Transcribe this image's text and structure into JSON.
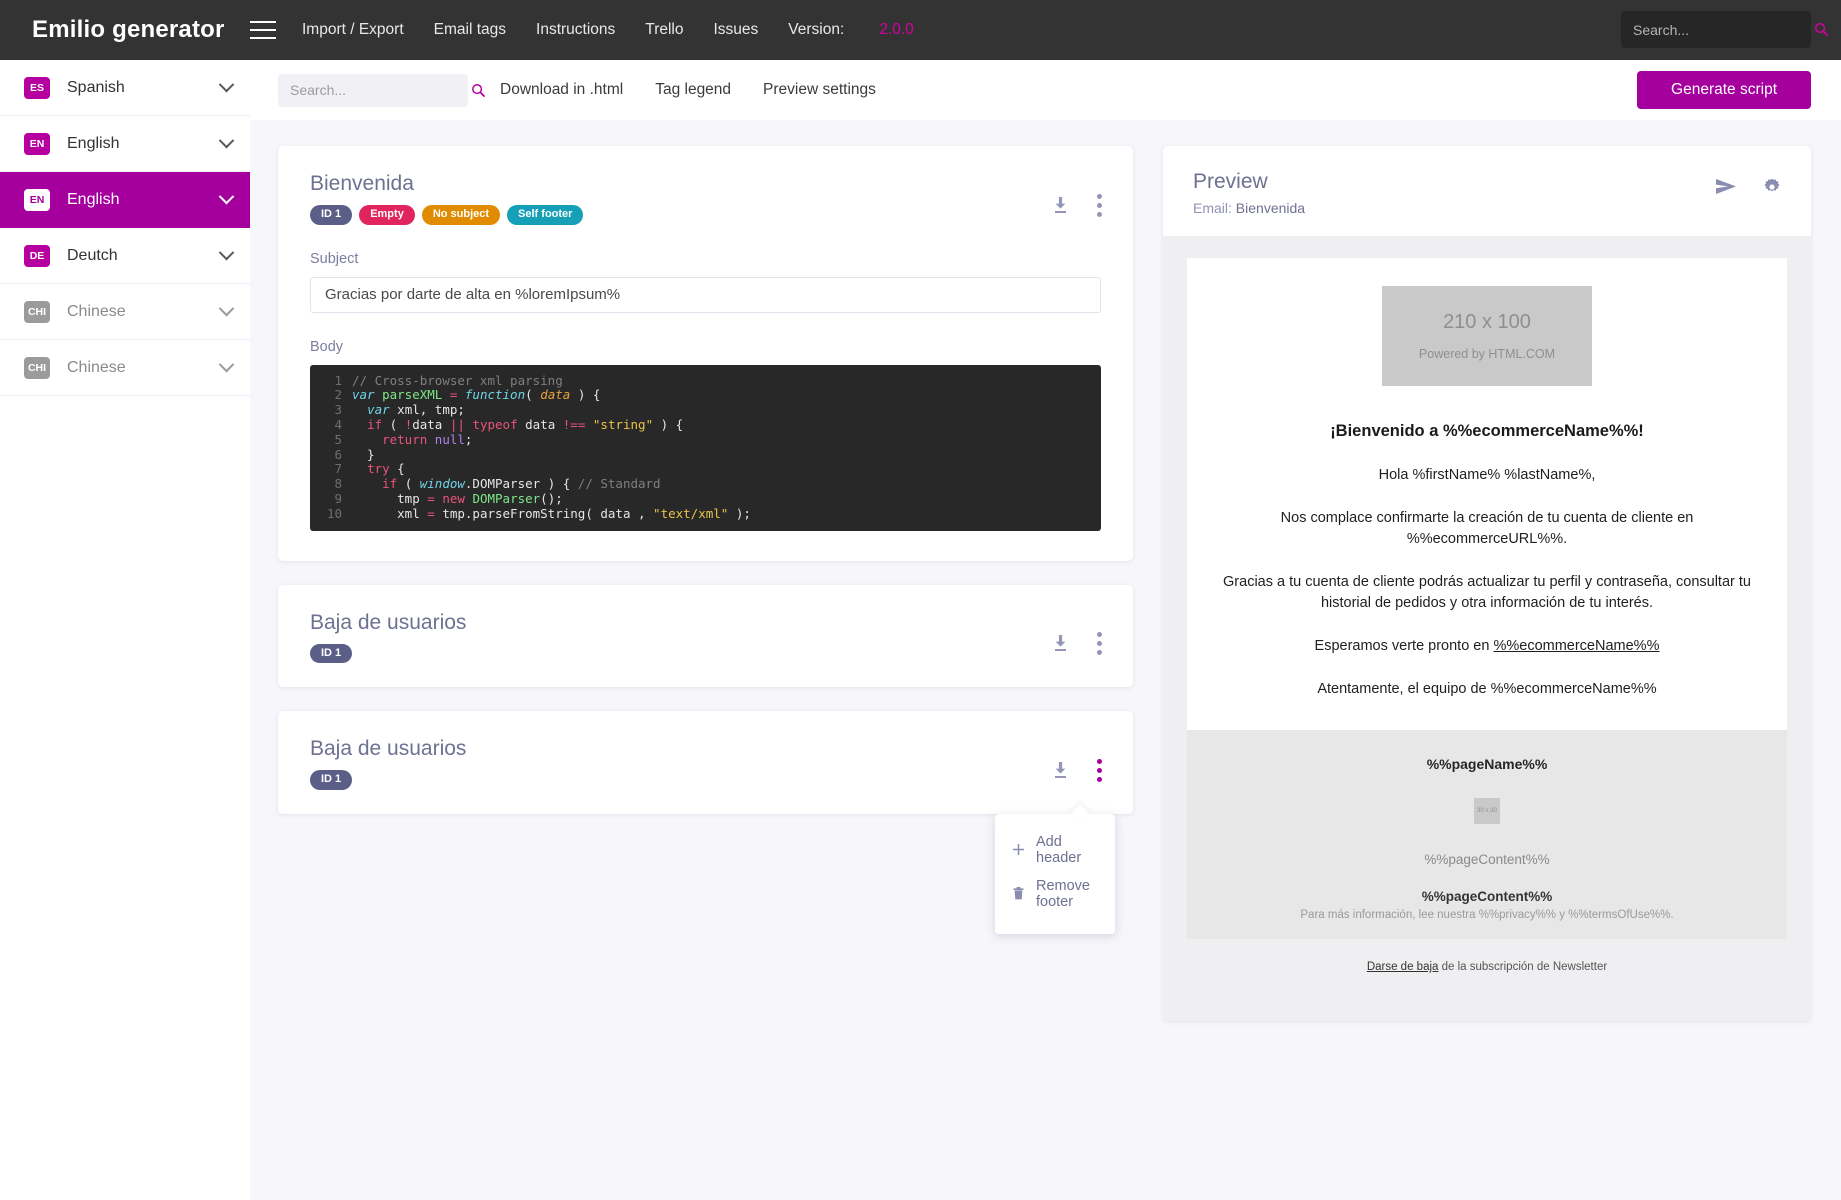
{
  "header": {
    "brand": "Emilio generator",
    "nav": [
      {
        "label": "Import / Export"
      },
      {
        "label": "Email tags"
      },
      {
        "label": "Instructions"
      },
      {
        "label": "Trello"
      },
      {
        "label": "Issues"
      }
    ],
    "version_label": "Version:",
    "version_value": "2.0.0",
    "search_placeholder": "Search...",
    "search_value": ""
  },
  "sidebar": {
    "items": [
      {
        "code": "ES",
        "label": "Spanish",
        "state": "normal"
      },
      {
        "code": "EN",
        "label": "English",
        "state": "normal"
      },
      {
        "code": "EN",
        "label": "English",
        "state": "active"
      },
      {
        "code": "DE",
        "label": "Deutch",
        "state": "normal"
      },
      {
        "code": "CHI",
        "label": "Chinese",
        "state": "disabled"
      },
      {
        "code": "CHI",
        "label": "Chinese",
        "state": "disabled"
      }
    ]
  },
  "toolbar": {
    "search_placeholder": "Search...",
    "search_value": "",
    "links": [
      {
        "label": "Download in .html"
      },
      {
        "label": "Tag legend"
      },
      {
        "label": "Preview settings"
      }
    ],
    "generate_label": "Generate script"
  },
  "cards": [
    {
      "title": "Bienvenida",
      "badges": [
        {
          "text": "ID 1",
          "color": "#5b5f87"
        },
        {
          "text": "Empty",
          "color": "#e0245e"
        },
        {
          "text": "No subject",
          "color": "#e08b00"
        },
        {
          "text": "Self footer",
          "color": "#16a0b8"
        }
      ],
      "subject_label": "Subject",
      "subject_value": "Gracias por darte de alta en %loremIpsum%",
      "body_label": "Body"
    },
    {
      "title": "Baja de usuarios",
      "badges": [
        {
          "text": "ID 1",
          "color": "#5b5f87"
        }
      ]
    },
    {
      "title": "Baja de usuarios",
      "badges": [
        {
          "text": "ID 1",
          "color": "#5b5f87"
        }
      ]
    }
  ],
  "code": {
    "lines": [
      {
        "n": "1",
        "tokens": [
          {
            "t": "// Cross-browser xml parsing",
            "c": "cm"
          }
        ]
      },
      {
        "n": "2",
        "tokens": [
          {
            "t": "var ",
            "c": "it"
          },
          {
            "t": "parseXML ",
            "c": "fn"
          },
          {
            "t": "= ",
            "c": "op"
          },
          {
            "t": "function",
            "c": "it"
          },
          {
            "t": "( ",
            "c": "df"
          },
          {
            "t": "data",
            "c": "pr"
          },
          {
            "t": " ) {",
            "c": "df"
          }
        ]
      },
      {
        "n": "3",
        "tokens": [
          {
            "t": "  ",
            "c": "df"
          },
          {
            "t": "var ",
            "c": "it"
          },
          {
            "t": "xml, tmp;",
            "c": "df"
          }
        ]
      },
      {
        "n": "4",
        "tokens": [
          {
            "t": "  ",
            "c": "df"
          },
          {
            "t": "if",
            "c": "kw"
          },
          {
            "t": " ( ",
            "c": "df"
          },
          {
            "t": "!",
            "c": "op"
          },
          {
            "t": "data ",
            "c": "df"
          },
          {
            "t": "|| ",
            "c": "op"
          },
          {
            "t": "typeof ",
            "c": "kw"
          },
          {
            "t": "data ",
            "c": "df"
          },
          {
            "t": "!== ",
            "c": "op"
          },
          {
            "t": "\"string\"",
            "c": "st"
          },
          {
            "t": " ) {",
            "c": "df"
          }
        ]
      },
      {
        "n": "5",
        "tokens": [
          {
            "t": "    ",
            "c": "df"
          },
          {
            "t": "return ",
            "c": "kw"
          },
          {
            "t": "null",
            "c": "nl"
          },
          {
            "t": ";",
            "c": "df"
          }
        ]
      },
      {
        "n": "6",
        "tokens": [
          {
            "t": "  }",
            "c": "df"
          }
        ]
      },
      {
        "n": "7",
        "tokens": [
          {
            "t": "  ",
            "c": "df"
          },
          {
            "t": "try",
            "c": "kw"
          },
          {
            "t": " {",
            "c": "df"
          }
        ]
      },
      {
        "n": "8",
        "tokens": [
          {
            "t": "    ",
            "c": "df"
          },
          {
            "t": "if",
            "c": "kw"
          },
          {
            "t": " ( ",
            "c": "df"
          },
          {
            "t": "window",
            "c": "it"
          },
          {
            "t": ".DOMParser ) { ",
            "c": "df"
          },
          {
            "t": "// Standard",
            "c": "cm"
          }
        ]
      },
      {
        "n": "9",
        "tokens": [
          {
            "t": "      tmp ",
            "c": "df"
          },
          {
            "t": "= ",
            "c": "op"
          },
          {
            "t": "new ",
            "c": "kw"
          },
          {
            "t": "DOMParser",
            "c": "cl"
          },
          {
            "t": "();",
            "c": "df"
          }
        ]
      },
      {
        "n": "10",
        "tokens": [
          {
            "t": "      xml ",
            "c": "df"
          },
          {
            "t": "= ",
            "c": "op"
          },
          {
            "t": "tmp.parseFromString( data , ",
            "c": "df"
          },
          {
            "t": "\"text/xml\"",
            "c": "st"
          },
          {
            "t": " );",
            "c": "df"
          }
        ]
      }
    ]
  },
  "menu": {
    "items": [
      {
        "icon": "plus-icon",
        "label": "Add header"
      },
      {
        "icon": "trash-icon",
        "label": "Remove footer"
      }
    ]
  },
  "preview": {
    "title": "Preview",
    "email_prefix": "Email:",
    "email_name": "Bienvenida",
    "header_image": {
      "size": "210 x 100",
      "credit": "Powered by HTML.COM"
    },
    "heading": "¡Bienvenido a %%ecommerceName%%!",
    "paragraphs": [
      "Hola %firstName% %lastName%,",
      "Nos complace confirmarte la creación de tu cuenta de cliente en %%ecommerceURL%%.",
      "Gracias a tu cuenta de cliente podrás actualizar tu perfil y contraseña, consultar tu historial de pedidos y otra información de tu interés."
    ],
    "line_link_prefix": "Esperamos verte pronto en ",
    "line_link": "%%ecommerceName%%",
    "signoff": "Atentamente, el equipo de %%ecommerceName%%",
    "footer": {
      "page_name": "%%pageName%%",
      "small_image": "30 x 30",
      "page_content_1": "%%pageContent%%",
      "page_content_2": "%%pageContent%%",
      "info": "Para más información, lee nuestra %%privacy%% y %%termsOfUse%%."
    },
    "unsubscribe_link": "Darse de baja",
    "unsubscribe_rest": " de la subscripción de Newsletter"
  },
  "colors": {
    "accent": "#a5009e",
    "topbar": "#333333",
    "content_bg": "#f7f6fa"
  }
}
